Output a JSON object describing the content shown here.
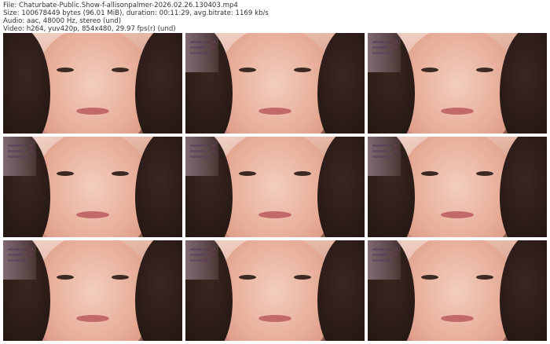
{
  "header": {
    "file": "File: Chaturbate-Public.Show-f-allisonpalmer-2026.02.26.130403.mp4",
    "size": "Size: 100678449 bytes (96.01 MiB), duration: 00:11:29, avg.bitrate: 1169 kb/s",
    "audio": "Audio: aac, 48000 Hz, stereo (und)",
    "video": "Video: h264, yuv420p, 854x480, 29.97 fps(r) (und)"
  },
  "thumbnails": [
    {
      "index": 1
    },
    {
      "index": 2
    },
    {
      "index": 3
    },
    {
      "index": 4
    },
    {
      "index": 5
    },
    {
      "index": 6
    },
    {
      "index": 7
    },
    {
      "index": 8
    },
    {
      "index": 9
    }
  ]
}
